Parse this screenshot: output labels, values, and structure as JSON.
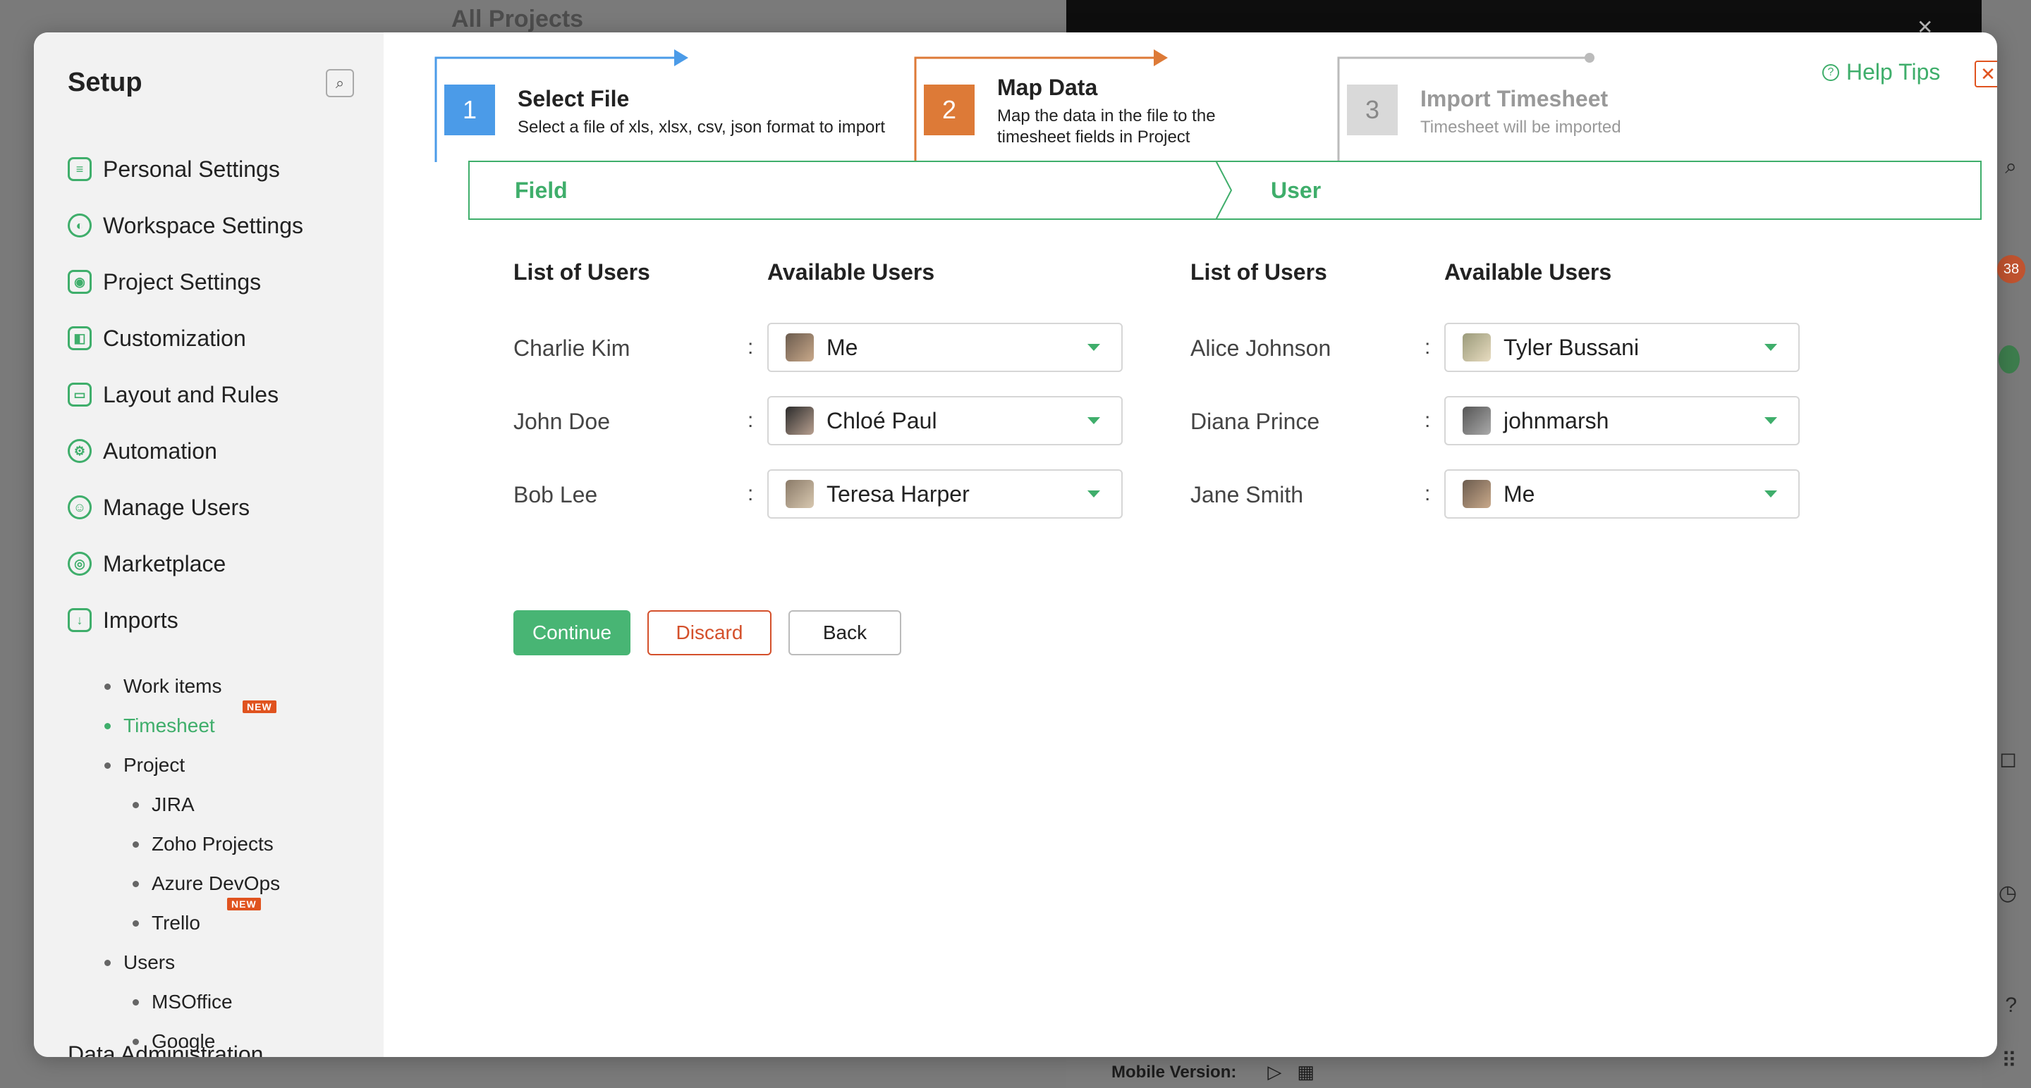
{
  "background": {
    "title": "All Projects",
    "mobile_label": "Mobile Version:",
    "rail_badge": "38"
  },
  "sidebar": {
    "title": "Setup",
    "items": [
      {
        "label": "Personal Settings",
        "icon": "personal-settings-icon"
      },
      {
        "label": "Workspace Settings",
        "icon": "workspace-settings-icon"
      },
      {
        "label": "Project Settings",
        "icon": "project-settings-icon"
      },
      {
        "label": "Customization",
        "icon": "customization-icon"
      },
      {
        "label": "Layout and Rules",
        "icon": "layout-rules-icon"
      },
      {
        "label": "Automation",
        "icon": "automation-icon"
      },
      {
        "label": "Manage Users",
        "icon": "manage-users-icon"
      },
      {
        "label": "Marketplace",
        "icon": "marketplace-icon"
      },
      {
        "label": "Imports",
        "icon": "imports-icon"
      }
    ],
    "imports_sub": {
      "work_items": "Work items",
      "timesheet": "Timesheet",
      "project": "Project",
      "jira": "JIRA",
      "zoho_projects": "Zoho Projects",
      "azure_devops": "Azure DevOps",
      "trello": "Trello",
      "users": "Users",
      "msoffice": "MSOffice",
      "google": "Google"
    },
    "new_badge": "NEW",
    "truncated_item": "Data Administration"
  },
  "steps": [
    {
      "num": "1",
      "title": "Select File",
      "desc": "Select a file of xls, xlsx, csv, json format to import",
      "color": "#4b9be8"
    },
    {
      "num": "2",
      "title": "Map Data",
      "desc_line1": "Map the data in the file to the",
      "desc_line2": "timesheet fields in Project",
      "color": "#dd7a37"
    },
    {
      "num": "3",
      "title": "Import Timesheet",
      "desc": "Timesheet will be imported",
      "color": "#d9d9d9"
    }
  ],
  "help_tips": "Help Tips",
  "tabs": {
    "field": "Field",
    "user": "User"
  },
  "mapping": {
    "col_list": "List of Users",
    "col_available": "Available Users",
    "left": [
      {
        "name": "Charlie Kim",
        "selected": "Me"
      },
      {
        "name": "John Doe",
        "selected": "Chloé Paul"
      },
      {
        "name": "Bob Lee",
        "selected": "Teresa Harper"
      }
    ],
    "right": [
      {
        "name": "Alice Johnson",
        "selected": "Tyler Bussani"
      },
      {
        "name": "Diana Prince",
        "selected": "johnmarsh"
      },
      {
        "name": "Jane Smith",
        "selected": "Me"
      }
    ]
  },
  "buttons": {
    "continue": "Continue",
    "discard": "Discard",
    "back": "Back"
  },
  "colors": {
    "accent": "#3fae6b",
    "step1": "#4b9be8",
    "step2": "#dd7a37",
    "discard": "#d4502b"
  }
}
